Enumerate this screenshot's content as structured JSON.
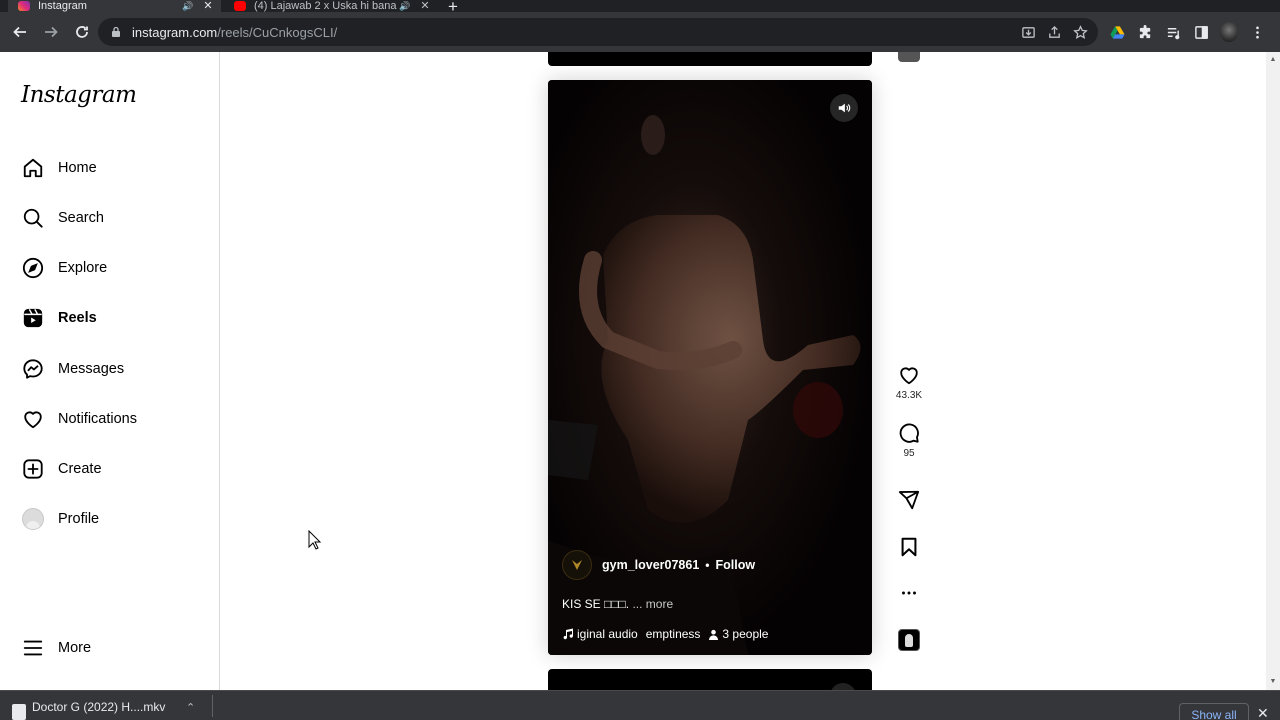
{
  "browser": {
    "tabs": [
      {
        "title": "Instagram",
        "active": true,
        "favicon_color": "#e1306c"
      },
      {
        "title": "(4) Lajawab 2 x Uska hi bana",
        "active": false,
        "favicon_color": "#ff0000"
      }
    ],
    "url_host": "instagram.com",
    "url_path": "/reels/CuCnkogsCLI/"
  },
  "sidebar": {
    "logo": "Instagram",
    "items": [
      {
        "label": "Home",
        "icon": "home-icon"
      },
      {
        "label": "Search",
        "icon": "search-icon"
      },
      {
        "label": "Explore",
        "icon": "compass-icon"
      },
      {
        "label": "Reels",
        "icon": "reels-icon",
        "active": true
      },
      {
        "label": "Messages",
        "icon": "messenger-icon"
      },
      {
        "label": "Notifications",
        "icon": "heart-icon"
      },
      {
        "label": "Create",
        "icon": "plus-square-icon"
      },
      {
        "label": "Profile",
        "icon": "avatar"
      }
    ],
    "more": "More"
  },
  "reel": {
    "author": "gym_lover07861",
    "separator": "•",
    "follow": "Follow",
    "caption": "KIS SE □□□.",
    "caption_more": "... more",
    "audio_text": "iginal audio",
    "audio_artist": "emptiness",
    "people": "3 people"
  },
  "actions": {
    "likes": "43.3K",
    "comments": "95"
  },
  "downloads": {
    "file": "Doctor G (2022) H....mkv",
    "show_all": "Show all"
  }
}
